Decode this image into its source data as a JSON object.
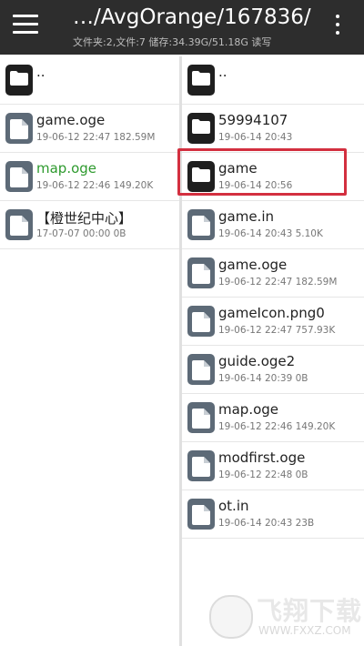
{
  "header": {
    "path": "…/AvgOrange/167836/",
    "storage_info": "文件夹:2,文件:7  储存:34.39G/51.18G  读写"
  },
  "left_pane": {
    "items": [
      {
        "name": "..",
        "meta": "",
        "icon": "folder-icon"
      },
      {
        "name": "game.oge",
        "meta": "19-06-12 22:47  182.59M",
        "icon": "file-icon"
      },
      {
        "name": "map.oge",
        "meta": "19-06-12 22:46  149.20K",
        "icon": "file-icon",
        "highlight_color": "#2e9a2e"
      },
      {
        "name": "【橙世纪中心】",
        "meta": "17-07-07 00:00  0B",
        "icon": "file-icon"
      }
    ]
  },
  "right_pane": {
    "items": [
      {
        "name": "..",
        "meta": "",
        "icon": "folder-icon"
      },
      {
        "name": "59994107",
        "meta": "19-06-14 20:43",
        "icon": "folder-icon"
      },
      {
        "name": "game",
        "meta": "19-06-14 20:56",
        "icon": "folder-icon",
        "boxed_color": "#d32f3f"
      },
      {
        "name": "game.in",
        "meta": "19-06-14 20:43  5.10K",
        "icon": "file-icon"
      },
      {
        "name": "game.oge",
        "meta": "19-06-12 22:47  182.59M",
        "icon": "file-icon"
      },
      {
        "name": "gameIcon.png0",
        "meta": "19-06-12 22:47  757.93K",
        "icon": "file-icon"
      },
      {
        "name": "guide.oge2",
        "meta": "19-06-14 20:39  0B",
        "icon": "file-icon"
      },
      {
        "name": "map.oge",
        "meta": "19-06-12 22:46  149.20K",
        "icon": "file-icon"
      },
      {
        "name": "modfirst.oge",
        "meta": "19-06-12 22:48  0B",
        "icon": "file-icon"
      },
      {
        "name": "ot.in",
        "meta": "19-06-14 20:43  23B",
        "icon": "file-icon"
      }
    ]
  },
  "watermark": {
    "brand": "飞翔下载",
    "url": "WWW.FXXZ.COM"
  }
}
